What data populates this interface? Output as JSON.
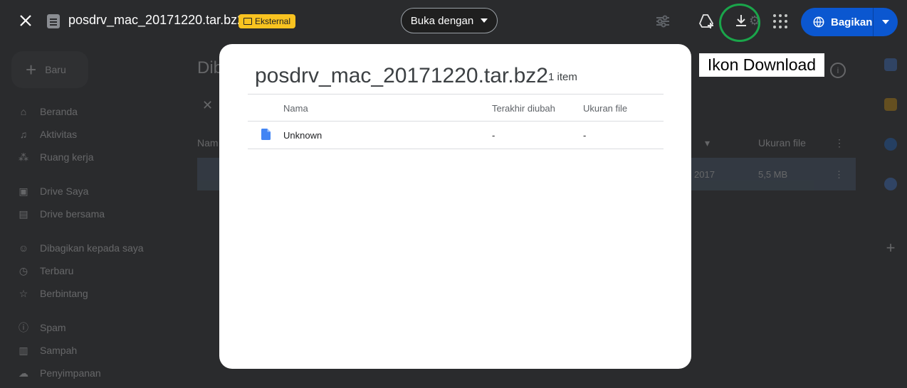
{
  "topbar": {
    "file_title": "posdrv_mac_20171220.tar.bz2",
    "external_badge": "Eksternal",
    "open_with_label": "Buka dengan",
    "share_label": "Bagikan",
    "icons": [
      "close-icon",
      "file-icon",
      "settings-sliders-icon",
      "add-to-drive-icon",
      "download-icon",
      "more-vert-icon",
      "apps-grid-icon",
      "globe-icon",
      "chevron-down-icon"
    ]
  },
  "annotation": {
    "callout_text": "Ikon Download",
    "highlight_color": "#1aa54a"
  },
  "modal": {
    "title": "posdrv_mac_20171220.tar.bz2",
    "item_count": "1 item",
    "columns": [
      "Nama",
      "Terakhir diubah",
      "Ukuran file"
    ],
    "rows": [
      {
        "name": "Unknown",
        "modified": "-",
        "size": "-"
      }
    ]
  },
  "background": {
    "new_button": "Baru",
    "title_partial": "Dib",
    "nav": [
      "Beranda",
      "Aktivitas",
      "Ruang kerja",
      "Drive Saya",
      "Drive bersama",
      "Dibagikan kepada saya",
      "Terbaru",
      "Berbintang",
      "Spam",
      "Sampah",
      "Penyimpanan"
    ],
    "col_name_partial": "Nam",
    "col_size": "Ukuran file",
    "row_date_partial": "2017",
    "row_size": "5,5 MB"
  },
  "colors": {
    "accent": "#0b57d0",
    "badge": "#f9c320",
    "doc": "#4285f4"
  }
}
